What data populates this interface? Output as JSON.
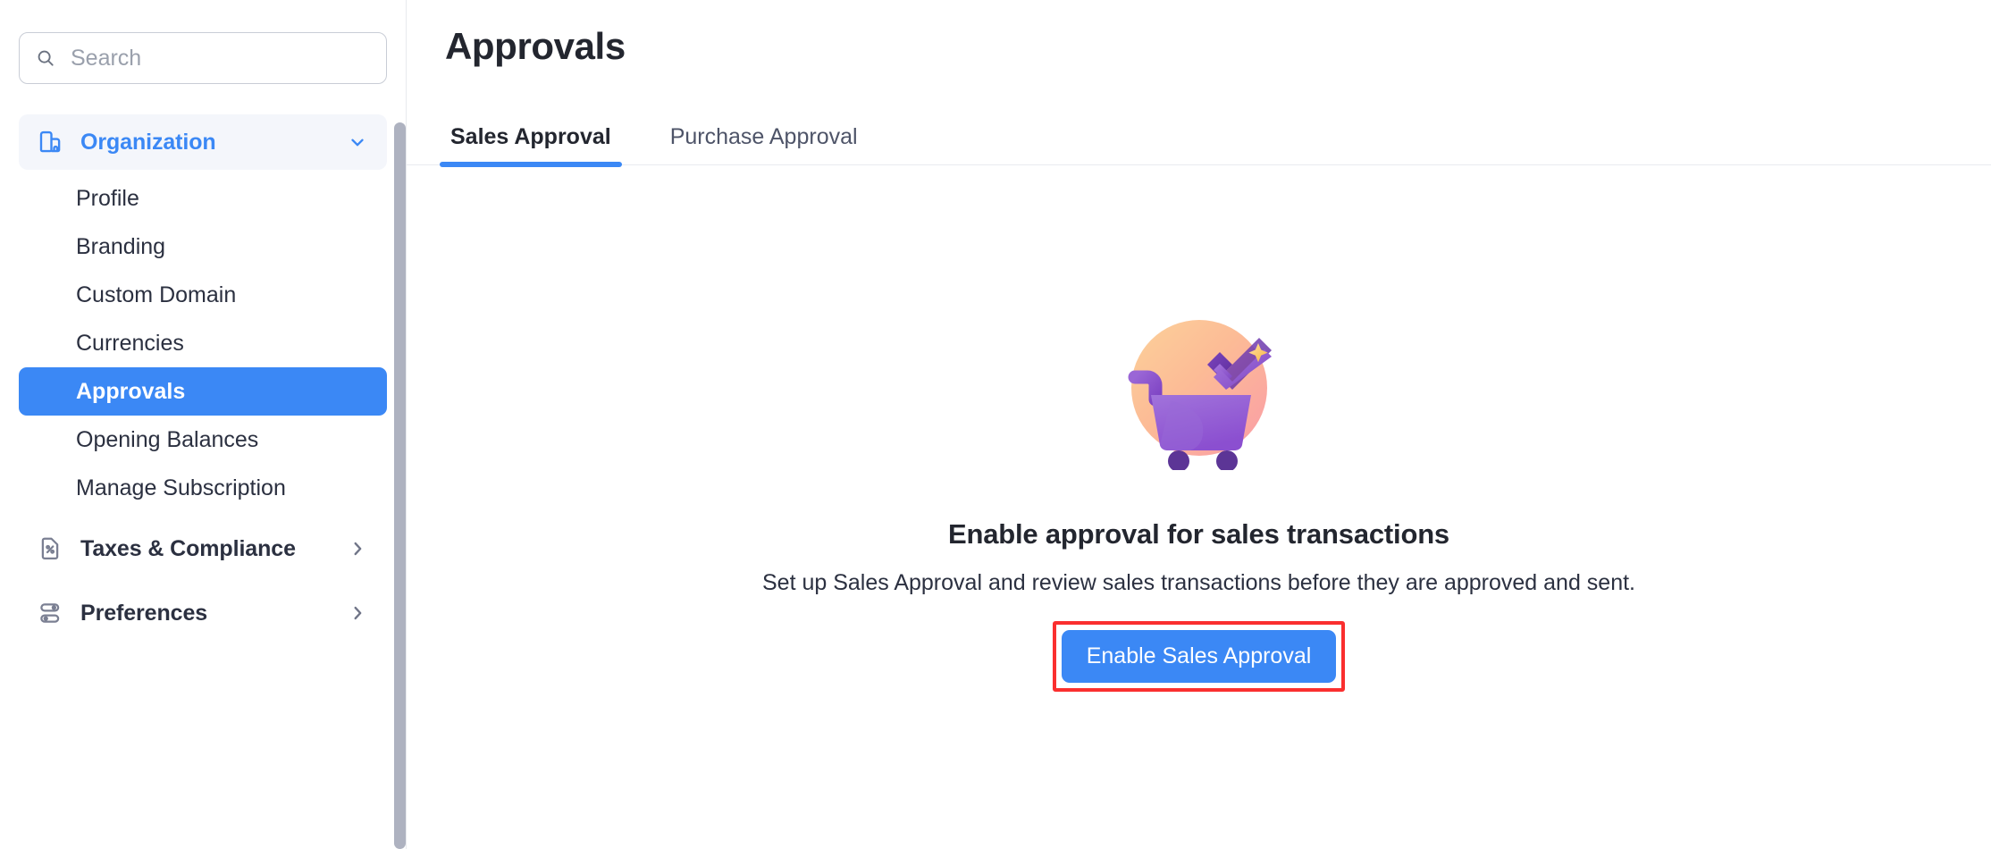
{
  "sidebar": {
    "search": {
      "placeholder": "Search",
      "value": "",
      "icon": "search-icon"
    },
    "groups": [
      {
        "label": "Organization",
        "icon": "organization-icon",
        "expanded": true,
        "chevron": "chevron-down-icon",
        "accent_color": "#3b88f5",
        "items": [
          {
            "label": "Profile",
            "selected": false
          },
          {
            "label": "Branding",
            "selected": false
          },
          {
            "label": "Custom Domain",
            "selected": false
          },
          {
            "label": "Currencies",
            "selected": false
          },
          {
            "label": "Approvals",
            "selected": true
          },
          {
            "label": "Opening Balances",
            "selected": false
          },
          {
            "label": "Manage Subscription",
            "selected": false
          }
        ]
      },
      {
        "label": "Taxes & Compliance",
        "icon": "tax-document-icon",
        "expanded": false,
        "chevron": "chevron-right-icon",
        "items": []
      },
      {
        "label": "Preferences",
        "icon": "preferences-sliders-icon",
        "expanded": false,
        "chevron": "chevron-right-icon",
        "items": []
      }
    ],
    "scrollbar": {
      "name": "sidebar-scrollbar"
    }
  },
  "main": {
    "title": "Approvals",
    "tabs": [
      {
        "label": "Sales Approval",
        "active": true
      },
      {
        "label": "Purchase Approval",
        "active": false
      }
    ],
    "empty_state": {
      "illustration": "shopping-cart-check-illustration",
      "title": "Enable approval for sales transactions",
      "description": "Set up Sales Approval and review sales transactions before they are approved and sent.",
      "cta_label": "Enable Sales Approval",
      "cta_color": "#3b88f5",
      "highlight_color": "#fa2f2f"
    }
  }
}
